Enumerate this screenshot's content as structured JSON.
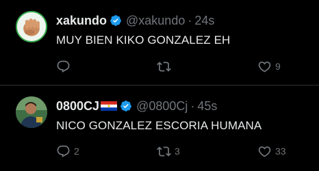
{
  "tweets": [
    {
      "name": "xakundo",
      "handle": "@xakundo",
      "separator": "·",
      "time": "24s",
      "text": "MUY BIEN KIKO GONZALEZ EH",
      "replies": "",
      "retweets": "",
      "likes": "9",
      "avatar_icon": "fist-pointing-icon"
    },
    {
      "name": "0800CJ",
      "handle": "@0800Cj",
      "separator": "·",
      "time": "45s",
      "text": "NICO GONZALEZ ESCORIA HUMANA",
      "replies": "2",
      "retweets": "3",
      "likes": "33",
      "flag_icon": "paraguay-flag-icon"
    }
  ],
  "colors": {
    "background": "#000000",
    "text": "#e7e9ea",
    "muted": "#71767b",
    "verified": "#1d9bf0",
    "divider": "#2f3336"
  }
}
